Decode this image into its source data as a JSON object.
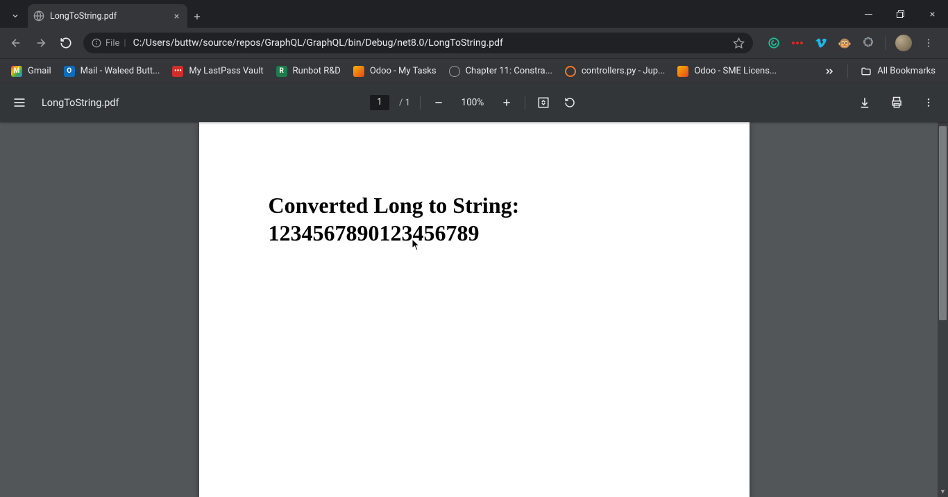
{
  "tab": {
    "title": "LongToString.pdf"
  },
  "omnibox": {
    "scheme_label": "File",
    "url": "C:/Users/buttw/source/repos/GraphQL/GraphQL/bin/Debug/net8.0/LongToString.pdf"
  },
  "bookmarks": {
    "items": [
      {
        "label": "Gmail"
      },
      {
        "label": "Mail - Waleed Butt..."
      },
      {
        "label": "My LastPass Vault"
      },
      {
        "label": "Runbot R&D"
      },
      {
        "label": "Odoo - My Tasks"
      },
      {
        "label": "Chapter 11: Constra..."
      },
      {
        "label": "controllers.py - Jup..."
      },
      {
        "label": "Odoo - SME Licens..."
      }
    ],
    "all_bookmarks_label": "All Bookmarks"
  },
  "pdf": {
    "filename": "LongToString.pdf",
    "page_current": "1",
    "page_total": "1",
    "zoom": "100%",
    "content_line1": "Converted Long to String:",
    "content_line2": "1234567890123456789"
  }
}
